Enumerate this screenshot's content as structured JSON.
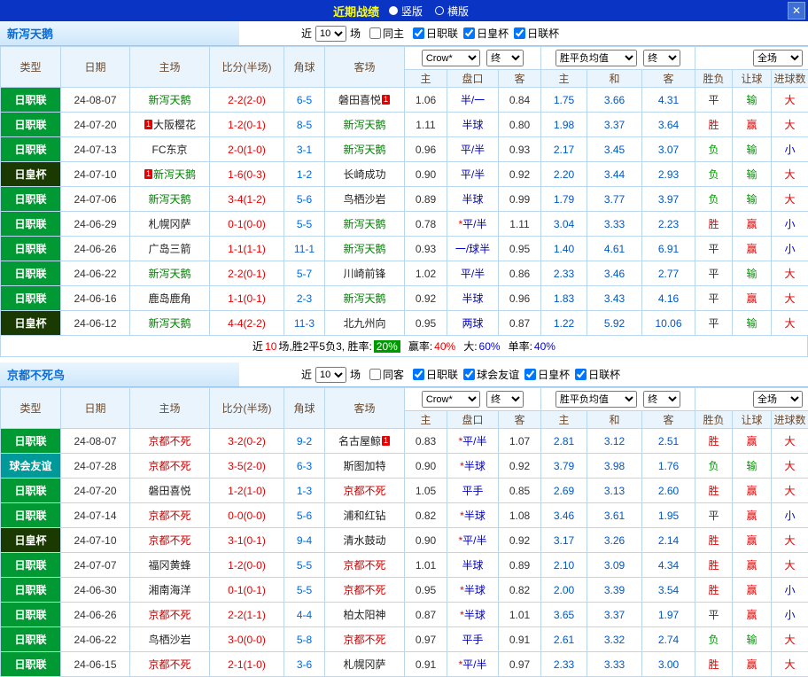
{
  "titlebar": {
    "title": "近期战绩",
    "radios": {
      "vertical": "竖版",
      "horizontal": "横版",
      "selected": "竖版"
    },
    "close": "✕"
  },
  "colors": {
    "titlebar_bg": "#0a34c4",
    "title_text": "#ffff00",
    "league_green": "#009933",
    "cup_dark": "#1b3a02",
    "friendly_teal": "#009999",
    "score_red": "#e60000",
    "corner_blue": "#0066dd",
    "odds_blue": "#0057c8",
    "win_rate_badge": "#009900"
  },
  "sections": [
    {
      "team": "新泻天鹅",
      "focus_color": "#008000",
      "near_label": "近",
      "count": "10",
      "games_label": "场",
      "same": {
        "label": "同主",
        "checked": false
      },
      "comps": [
        {
          "label": "日职联",
          "checked": true
        },
        {
          "label": "日皇杯",
          "checked": true
        },
        {
          "label": "日联杯",
          "checked": true
        }
      ],
      "header": {
        "type": "类型",
        "date": "日期",
        "home": "主场",
        "score": "比分(半场)",
        "corner": "角球",
        "away": "客场",
        "odds_select": "Crow*",
        "odds_final": "终",
        "euro_select": "胜平负均值",
        "euro_final": "终",
        "scope_select": "全场",
        "h": "主",
        "hc": "盘口",
        "a": "客",
        "eh": "主",
        "ed": "和",
        "ea": "客",
        "wdl": "胜负",
        "hc_res": "让球",
        "goals": "进球数"
      },
      "rows": [
        {
          "type": "日职联",
          "date": "24-08-07",
          "home": "新泻天鹅",
          "hf": true,
          "score": "2-2(2-0)",
          "corner": "6-5",
          "away": "磐田喜悦",
          "away_post": "1",
          "h": "1.06",
          "hc": "半/一",
          "a": "0.84",
          "e1": "1.75",
          "ex": "3.66",
          "e2": "4.31",
          "r1": "平",
          "r2": "输",
          "r3": "大"
        },
        {
          "type": "日职联",
          "date": "24-07-20",
          "home_pre": "1",
          "home": "大阪樱花",
          "score": "1-2(0-1)",
          "corner": "8-5",
          "away": "新泻天鹅",
          "af": true,
          "h": "1.11",
          "hc": "半球",
          "a": "0.80",
          "e1": "1.98",
          "ex": "3.37",
          "e2": "3.64",
          "r1": "胜",
          "r2": "赢",
          "r3": "大"
        },
        {
          "type": "日职联",
          "date": "24-07-13",
          "home": "FC东京",
          "score": "2-0(1-0)",
          "corner": "3-1",
          "away": "新泻天鹅",
          "af": true,
          "h": "0.96",
          "hc": "平/半",
          "a": "0.93",
          "e1": "2.17",
          "ex": "3.45",
          "e2": "3.07",
          "r1": "负",
          "r2": "输",
          "r3": "小"
        },
        {
          "type": "日皇杯",
          "date": "24-07-10",
          "home_pre": "1",
          "home": "新泻天鹅",
          "hf": true,
          "score": "1-6(0-3)",
          "corner": "1-2",
          "away": "长崎成功",
          "h": "0.90",
          "hc": "平/半",
          "a": "0.92",
          "e1": "2.20",
          "ex": "3.44",
          "e2": "2.93",
          "r1": "负",
          "r2": "输",
          "r3": "大"
        },
        {
          "type": "日职联",
          "date": "24-07-06",
          "home": "新泻天鹅",
          "hf": true,
          "score": "3-4(1-2)",
          "corner": "5-6",
          "away": "鸟栖沙岩",
          "h": "0.89",
          "hc": "半球",
          "a": "0.99",
          "e1": "1.79",
          "ex": "3.77",
          "e2": "3.97",
          "r1": "负",
          "r2": "输",
          "r3": "大"
        },
        {
          "type": "日职联",
          "date": "24-06-29",
          "home": "札幌冈萨",
          "score": "0-1(0-0)",
          "corner": "5-5",
          "away": "新泻天鹅",
          "af": true,
          "h": "0.78",
          "hc_star": "*",
          "hc": "平/半",
          "a": "1.11",
          "e1": "3.04",
          "ex": "3.33",
          "e2": "2.23",
          "r1": "胜",
          "r2": "赢",
          "r3": "小"
        },
        {
          "type": "日职联",
          "date": "24-06-26",
          "home": "广岛三箭",
          "score": "1-1(1-1)",
          "corner": "11-1",
          "away": "新泻天鹅",
          "af": true,
          "h": "0.93",
          "hc": "一/球半",
          "a": "0.95",
          "e1": "1.40",
          "ex": "4.61",
          "e2": "6.91",
          "r1": "平",
          "r2": "赢",
          "r3": "小"
        },
        {
          "type": "日职联",
          "date": "24-06-22",
          "home": "新泻天鹅",
          "hf": true,
          "score": "2-2(0-1)",
          "corner": "5-7",
          "away": "川崎前锋",
          "h": "1.02",
          "hc": "平/半",
          "a": "0.86",
          "e1": "2.33",
          "ex": "3.46",
          "e2": "2.77",
          "r1": "平",
          "r2": "输",
          "r3": "大"
        },
        {
          "type": "日职联",
          "date": "24-06-16",
          "home": "鹿岛鹿角",
          "score": "1-1(0-1)",
          "corner": "2-3",
          "away": "新泻天鹅",
          "af": true,
          "h": "0.92",
          "hc": "半球",
          "a": "0.96",
          "e1": "1.83",
          "ex": "3.43",
          "e2": "4.16",
          "r1": "平",
          "r2": "赢",
          "r3": "大"
        },
        {
          "type": "日皇杯",
          "date": "24-06-12",
          "home": "新泻天鹅",
          "hf": true,
          "score": "4-4(2-2)",
          "corner": "11-3",
          "away": "北九州向",
          "h": "0.95",
          "hc": "两球",
          "a": "0.87",
          "e1": "1.22",
          "ex": "5.92",
          "e2": "10.06",
          "r1": "平",
          "r2": "输",
          "r3": "大"
        }
      ],
      "summary": {
        "near": "近",
        "count": "10",
        "text": "场,胜2平5负3, 胜率:",
        "win_rate": "20%",
        "asia_label": "赢率:",
        "asia_value": "40%",
        "big_label": "大:",
        "big_value": "60%",
        "single_label": "单率:",
        "single_value": "40%"
      }
    },
    {
      "team": "京都不死鸟",
      "focus_color": "#cc0000",
      "near_label": "近",
      "count": "10",
      "games_label": "场",
      "same": {
        "label": "同客",
        "checked": false
      },
      "comps": [
        {
          "label": "日职联",
          "checked": true
        },
        {
          "label": "球会友谊",
          "checked": true
        },
        {
          "label": "日皇杯",
          "checked": true
        },
        {
          "label": "日联杯",
          "checked": true
        }
      ],
      "header": {
        "type": "类型",
        "date": "日期",
        "home": "主场",
        "score": "比分(半场)",
        "corner": "角球",
        "away": "客场",
        "odds_select": "Crow*",
        "odds_final": "终",
        "euro_select": "胜平负均值",
        "euro_final": "终",
        "scope_select": "全场",
        "h": "主",
        "hc": "盘口",
        "a": "客",
        "eh": "主",
        "ed": "和",
        "ea": "客",
        "wdl": "胜负",
        "hc_res": "让球",
        "goals": "进球数"
      },
      "rows": [
        {
          "type": "日职联",
          "date": "24-08-07",
          "home": "京都不死",
          "hf": true,
          "score": "3-2(0-2)",
          "corner": "9-2",
          "away": "名古屋鲸",
          "away_post": "1",
          "h": "0.83",
          "hc_star": "*",
          "hc": "平/半",
          "a": "1.07",
          "e1": "2.81",
          "ex": "3.12",
          "e2": "2.51",
          "r1": "胜",
          "r2": "赢",
          "r3": "大"
        },
        {
          "type": "球会友谊",
          "date": "24-07-28",
          "home": "京都不死",
          "hf": true,
          "score": "3-5(2-0)",
          "corner": "6-3",
          "away": "斯图加特",
          "h": "0.90",
          "hc_star": "*",
          "hc": "半球",
          "a": "0.92",
          "e1": "3.79",
          "ex": "3.98",
          "e2": "1.76",
          "r1": "负",
          "r2": "输",
          "r3": "大"
        },
        {
          "type": "日职联",
          "date": "24-07-20",
          "home": "磐田喜悦",
          "score": "1-2(1-0)",
          "corner": "1-3",
          "away": "京都不死",
          "af": true,
          "h": "1.05",
          "hc": "平手",
          "a": "0.85",
          "e1": "2.69",
          "ex": "3.13",
          "e2": "2.60",
          "r1": "胜",
          "r2": "赢",
          "r3": "大"
        },
        {
          "type": "日职联",
          "date": "24-07-14",
          "home": "京都不死",
          "hf": true,
          "score": "0-0(0-0)",
          "corner": "5-6",
          "away": "浦和红钻",
          "h": "0.82",
          "hc_star": "*",
          "hc": "半球",
          "a": "1.08",
          "e1": "3.46",
          "ex": "3.61",
          "e2": "1.95",
          "r1": "平",
          "r2": "赢",
          "r3": "小"
        },
        {
          "type": "日皇杯",
          "date": "24-07-10",
          "home": "京都不死",
          "hf": true,
          "score": "3-1(0-1)",
          "corner": "9-4",
          "away": "清水鼓动",
          "h": "0.90",
          "hc_star": "*",
          "hc": "平/半",
          "a": "0.92",
          "e1": "3.17",
          "ex": "3.26",
          "e2": "2.14",
          "r1": "胜",
          "r2": "赢",
          "r3": "大"
        },
        {
          "type": "日职联",
          "date": "24-07-07",
          "home": "福冈黄蜂",
          "score": "1-2(0-0)",
          "corner": "5-5",
          "away": "京都不死",
          "af": true,
          "h": "1.01",
          "hc": "半球",
          "a": "0.89",
          "e1": "2.10",
          "ex": "3.09",
          "e2": "4.34",
          "r1": "胜",
          "r2": "赢",
          "r3": "大"
        },
        {
          "type": "日职联",
          "date": "24-06-30",
          "home": "湘南海洋",
          "score": "0-1(0-1)",
          "corner": "5-5",
          "away": "京都不死",
          "af": true,
          "h": "0.95",
          "hc_star": "*",
          "hc": "半球",
          "a": "0.82",
          "e1": "2.00",
          "ex": "3.39",
          "e2": "3.54",
          "r1": "胜",
          "r2": "赢",
          "r3": "小"
        },
        {
          "type": "日职联",
          "date": "24-06-26",
          "home": "京都不死",
          "hf": true,
          "score": "2-2(1-1)",
          "corner": "4-4",
          "away": "柏太阳神",
          "h": "0.87",
          "hc_star": "*",
          "hc": "半球",
          "a": "1.01",
          "e1": "3.65",
          "ex": "3.37",
          "e2": "1.97",
          "r1": "平",
          "r2": "赢",
          "r3": "小"
        },
        {
          "type": "日职联",
          "date": "24-06-22",
          "home": "鸟栖沙岩",
          "score": "3-0(0-0)",
          "corner": "5-8",
          "away": "京都不死",
          "af": true,
          "h": "0.97",
          "hc": "平手",
          "a": "0.91",
          "e1": "2.61",
          "ex": "3.32",
          "e2": "2.74",
          "r1": "负",
          "r2": "输",
          "r3": "大"
        },
        {
          "type": "日职联",
          "date": "24-06-15",
          "home": "京都不死",
          "hf": true,
          "score": "2-1(1-0)",
          "corner": "3-6",
          "away": "札幌冈萨",
          "h": "0.91",
          "hc_star": "*",
          "hc": "平/半",
          "a": "0.97",
          "e1": "2.33",
          "ex": "3.33",
          "e2": "3.00",
          "r1": "胜",
          "r2": "赢",
          "r3": "大"
        }
      ]
    }
  ]
}
